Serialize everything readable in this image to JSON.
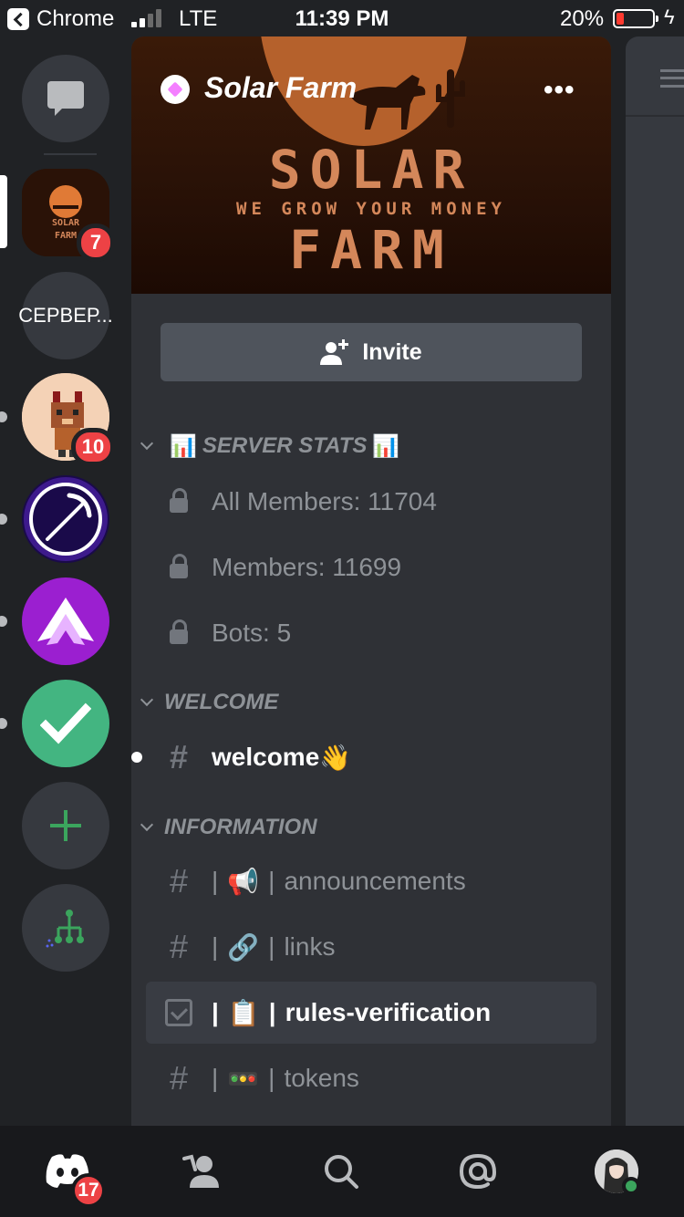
{
  "status_bar": {
    "carrier": "Chrome",
    "network": "LTE",
    "time": "11:39 PM",
    "battery": "20%",
    "battery_level": 0.2
  },
  "rail": {
    "servers": [
      {
        "name": "Direct Messages",
        "icon": "chat-bubble-icon"
      },
      {
        "name": "Solar Farm",
        "badge": "7",
        "selected": true
      },
      {
        "label": "СЕРВЕР..."
      },
      {
        "name": "Pixel Fox Server",
        "badge": "10"
      },
      {
        "name": "Pickaxe Server",
        "icon": "pickaxe-icon"
      },
      {
        "name": "Purple Wings Server",
        "icon": "wings-icon"
      },
      {
        "name": "Verified Server",
        "icon": "checkmark-icon"
      },
      {
        "name": "Add a Server",
        "icon": "plus-icon"
      },
      {
        "name": "Explore Public Servers",
        "icon": "hub-icon"
      }
    ]
  },
  "server": {
    "name": "Solar Farm",
    "more": "•••",
    "banner": {
      "line1": "SOLAR",
      "line2": "WE GROW YOUR MONEY",
      "line3": "FARM"
    },
    "invite_label": "Invite"
  },
  "categories": {
    "stats": {
      "name": "SERVER STATS",
      "emoji": "📊"
    },
    "welcome": {
      "name": "WELCOME"
    },
    "information": {
      "name": "INFORMATION"
    }
  },
  "channels": {
    "all_members": "All Members: 11704",
    "members": "Members: 11699",
    "bots": "Bots: 5",
    "welcome": "welcome",
    "welcome_emoji": "👋",
    "announcements_emoji": "📢",
    "announcements": "announcements",
    "links_emoji": "🔗",
    "links": "links",
    "rules_emoji": "📋",
    "rules": "rules-verification",
    "tokens_emoji": "🚥",
    "tokens": "tokens",
    "separator": "|"
  },
  "bottom_nav": {
    "home_badge": "17"
  },
  "colors": {
    "accent": "#5865f2",
    "badge": "#ed4245",
    "online": "#3ba55d",
    "green_server": "#43b581",
    "purple_server": "#9b1fd0"
  }
}
